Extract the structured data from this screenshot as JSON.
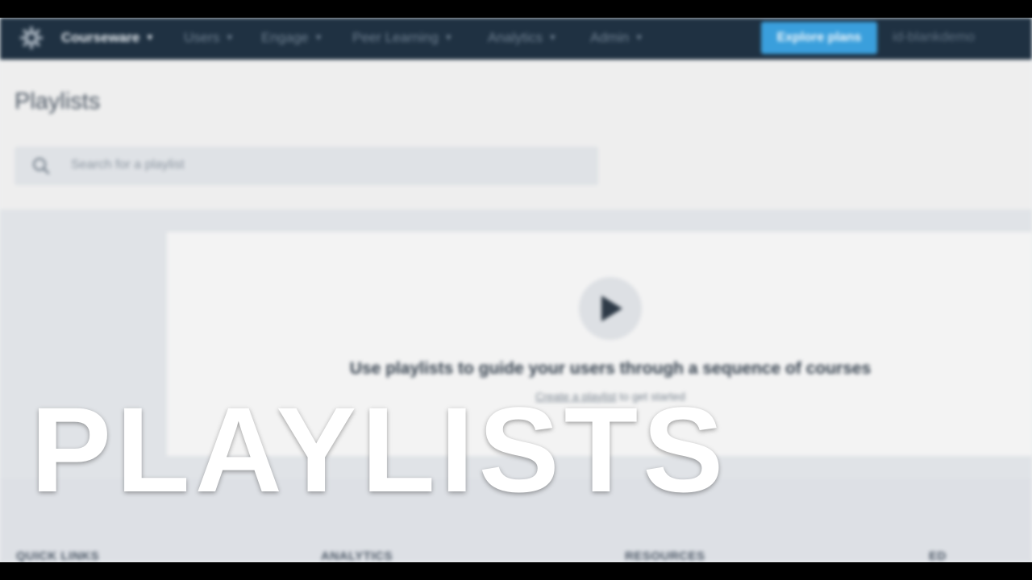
{
  "nav": {
    "items": [
      {
        "label": "Courseware",
        "active": true
      },
      {
        "label": "Users",
        "active": false
      },
      {
        "label": "Engage",
        "active": false
      },
      {
        "label": "Peer Learning",
        "active": false
      },
      {
        "label": "Analytics",
        "active": false
      },
      {
        "label": "Admin",
        "active": false
      }
    ],
    "explore_label": "Explore plans",
    "account_label": "id-blankdemo",
    "logo_icon": "gear-icon"
  },
  "page": {
    "title": "Playlists",
    "search_placeholder": "Search for a playlist"
  },
  "empty_state": {
    "icon": "play-icon",
    "title": "Use playlists to guide your users through a sequence of courses",
    "sub_link": "Create a playlist",
    "sub_rest": " to get started"
  },
  "footer": {
    "columns": [
      "QUICK LINKS",
      "ANALYTICS",
      "RESOURCES",
      "ED"
    ]
  },
  "overlay": {
    "title": "PLAYLISTS"
  },
  "colors": {
    "nav_bg": "#1f3142",
    "accent": "#3a9fdc",
    "overlay_text": "#ffffff"
  }
}
